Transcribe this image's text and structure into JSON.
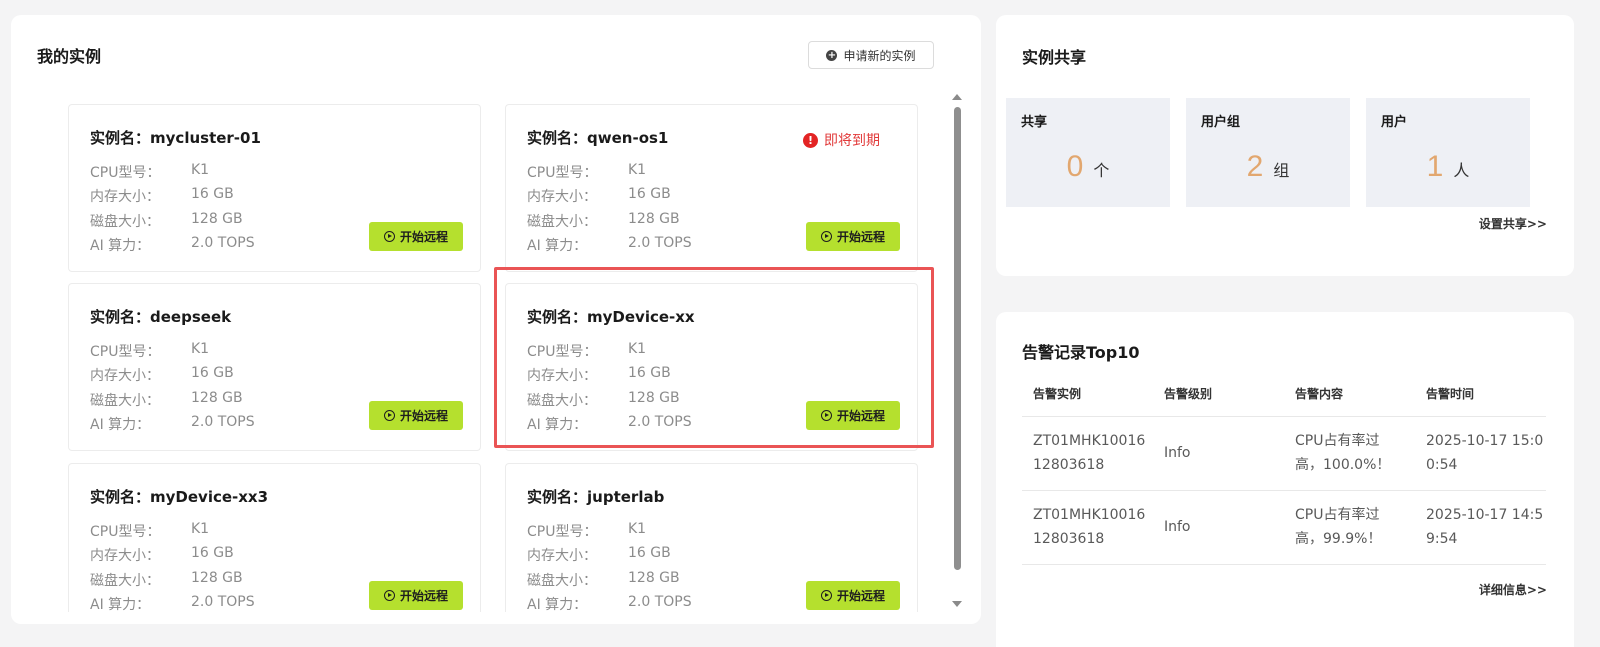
{
  "instances_panel": {
    "title": "我的实例",
    "apply_button": "申请新的实例",
    "labels": {
      "name_prefix": "实例名：",
      "cpu": "CPU型号：",
      "memory": "内存大小：",
      "disk": "磁盘大小：",
      "ai": "AI 算力："
    },
    "remote_button": "开始远程",
    "expire_text": "即将到期",
    "cards": [
      {
        "name": "mycluster-01",
        "cpu": "K1",
        "memory": "16 GB",
        "disk": "128 GB",
        "ai": "2.0 TOPS"
      },
      {
        "name": "qwen-os1",
        "cpu": "K1",
        "memory": "16 GB",
        "disk": "128 GB",
        "ai": "2.0 TOPS",
        "expiring": true
      },
      {
        "name": "deepseek",
        "cpu": "K1",
        "memory": "16 GB",
        "disk": "128 GB",
        "ai": "2.0 TOPS"
      },
      {
        "name": "myDevice-xx",
        "cpu": "K1",
        "memory": "16 GB",
        "disk": "128 GB",
        "ai": "2.0 TOPS"
      },
      {
        "name": "myDevice-xx3",
        "cpu": "K1",
        "memory": "16 GB",
        "disk": "128 GB",
        "ai": "2.0 TOPS"
      },
      {
        "name": "jupterlab",
        "cpu": "K1",
        "memory": "16 GB",
        "disk": "128 GB",
        "ai": "2.0 TOPS"
      }
    ]
  },
  "share_panel": {
    "title": "实例共享",
    "stats": [
      {
        "label": "共享",
        "value": "0",
        "unit": "个"
      },
      {
        "label": "用户组",
        "value": "2",
        "unit": "组"
      },
      {
        "label": "用户",
        "value": "1",
        "unit": "人"
      }
    ],
    "settings_link": "设置共享>>"
  },
  "alert_panel": {
    "title": "告警记录Top10",
    "columns": [
      "告警实例",
      "告警级别",
      "告警内容",
      "告警时间"
    ],
    "rows": [
      {
        "instance_l1": "ZT01MHK10016",
        "instance_l2": "12803618",
        "level": "Info",
        "content_l1": "CPU占有率过",
        "content_l2": "高，100.0%！",
        "time_l1": "2025-10-17 15:0",
        "time_l2": "0:54"
      },
      {
        "instance_l1": "ZT01MHK10016",
        "instance_l2": "12803618",
        "level": "Info",
        "content_l1": "CPU占有率过",
        "content_l2": "高，99.9%！",
        "time_l1": "2025-10-17 14:5",
        "time_l2": "9:54"
      }
    ],
    "more_link": "详细信息>>"
  },
  "colors": {
    "accent_green": "#b5e02e",
    "stat_number": "#e2a76f",
    "expire_red": "#e23b3b",
    "highlight_border": "#ea5455"
  }
}
